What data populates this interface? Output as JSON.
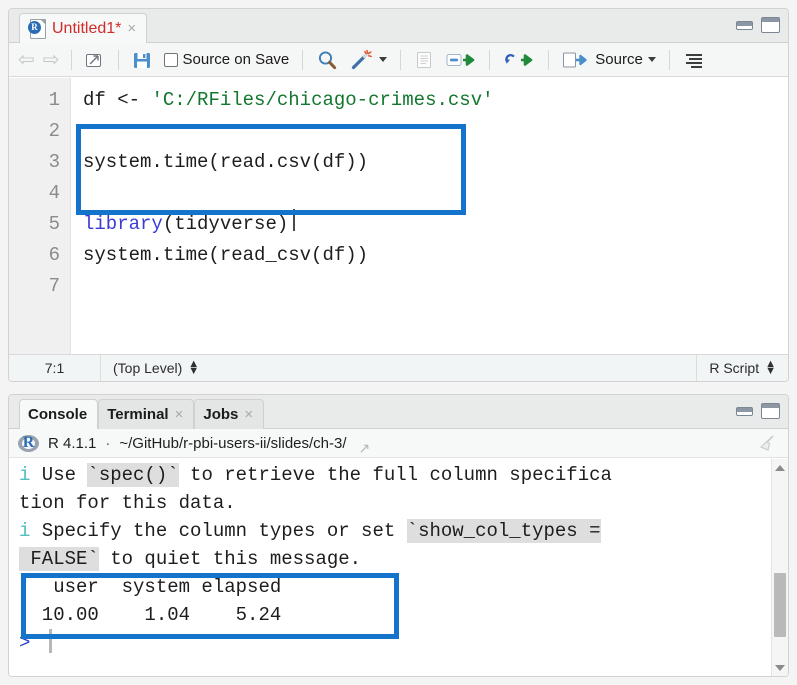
{
  "window": {
    "minimize_label": "minimize",
    "maximize_label": "maximize"
  },
  "source_panel": {
    "tabs": [
      {
        "label": "Untitled1*",
        "modified": true,
        "close": "×"
      }
    ],
    "toolbar": {
      "back_icon": "⇦",
      "forward_icon": "⇨",
      "popout_label": "show-in-new-window",
      "save_label": "save",
      "source_on_save_label": "Source on Save",
      "find_label": "find-replace",
      "magic_label": "code-tools",
      "compile_report_label": "compile-report",
      "run_label": "Run",
      "rerun_label": "re-run",
      "source_label": "Source",
      "outline_label": "document-outline"
    },
    "code_lines": [
      {
        "num": "1",
        "segments": [
          {
            "text": "df ",
            "cls": "tok-op"
          },
          {
            "text": "<- ",
            "cls": "tok-op"
          },
          {
            "text": "'C:/RFiles/chicago-crimes.csv'",
            "cls": "tok-str"
          }
        ]
      },
      {
        "num": "2",
        "segments": []
      },
      {
        "num": "3",
        "segments": [
          {
            "text": "system.time(read.csv(df))",
            "cls": "tok-op"
          }
        ]
      },
      {
        "num": "4",
        "segments": []
      },
      {
        "num": "5",
        "segments": [
          {
            "text": "library",
            "cls": "tok-fn"
          },
          {
            "text": "(tidyverse)",
            "cls": "tok-op"
          }
        ]
      },
      {
        "num": "6",
        "segments": [
          {
            "text": "system.time(read_csv(df))",
            "cls": "tok-op"
          }
        ]
      },
      {
        "num": "7",
        "segments": []
      }
    ],
    "status": {
      "cursor_position": "7:1",
      "scope": "(Top Level)",
      "doc_type": "R Script"
    }
  },
  "console_panel": {
    "tabs": [
      {
        "label": "Console",
        "closable": false,
        "active": true
      },
      {
        "label": "Terminal",
        "closable": true,
        "close": "×",
        "active": false
      },
      {
        "label": "Jobs",
        "closable": true,
        "close": "×",
        "active": false
      }
    ],
    "header": {
      "r_version": "R 4.1.1",
      "separator": "·",
      "working_directory": "~/GitHub/r-pbi-users-ii/slides/ch-3/",
      "clear_console_label": "clear-console"
    },
    "output_lines": [
      {
        "segments": [
          {
            "text": "i",
            "cls": "c-info"
          },
          {
            "text": " Use ",
            "cls": ""
          },
          {
            "text": "`spec()`",
            "cls": "c-code"
          },
          {
            "text": " to retrieve the full column specifica",
            "cls": ""
          }
        ]
      },
      {
        "segments": [
          {
            "text": "tion for this data.",
            "cls": ""
          }
        ]
      },
      {
        "segments": [
          {
            "text": "i",
            "cls": "c-info"
          },
          {
            "text": " Specify the column types or set ",
            "cls": ""
          },
          {
            "text": "`show_col_types =",
            "cls": "c-code"
          }
        ]
      },
      {
        "segments": [
          {
            "text": " FALSE`",
            "cls": "c-code"
          },
          {
            "text": " to quiet this message.",
            "cls": ""
          }
        ]
      },
      {
        "segments": [
          {
            "text": "   user  system elapsed ",
            "cls": ""
          }
        ]
      },
      {
        "segments": [
          {
            "text": "  10.00    1.04    5.24 ",
            "cls": ""
          }
        ]
      },
      {
        "segments": [
          {
            "text": "> ",
            "cls": "c-prompt"
          }
        ]
      }
    ],
    "timing_result": {
      "headers": [
        "user",
        "system",
        "elapsed"
      ],
      "values": [
        "10.00",
        "1.04",
        "5.24"
      ]
    }
  },
  "annotations": {
    "highlight_color": "#1473cb",
    "boxes": [
      {
        "name": "code-highlight",
        "note": "lines 5-6 tidyverse read_csv"
      },
      {
        "name": "timing-highlight",
        "note": "user/system/elapsed result"
      }
    ]
  }
}
